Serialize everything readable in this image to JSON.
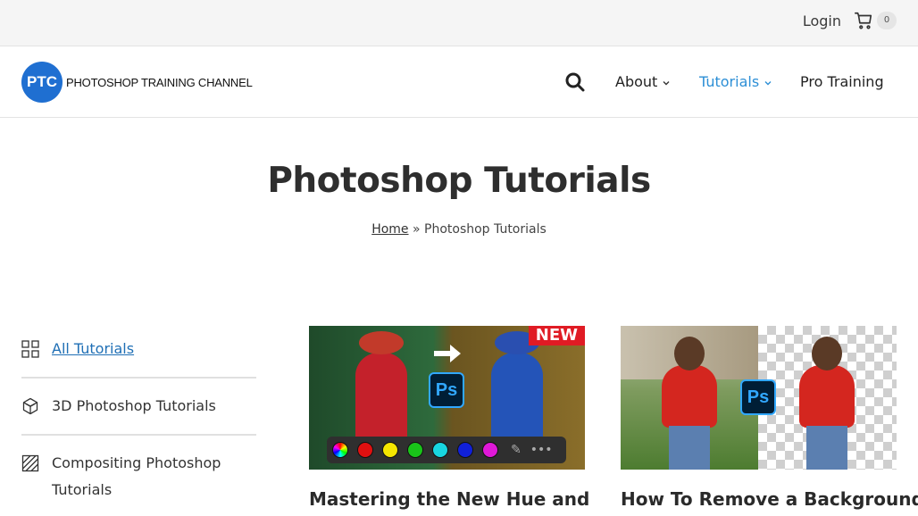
{
  "topbar": {
    "login_label": "Login",
    "cart_count": "0"
  },
  "header": {
    "logo_initials": "PTC",
    "logo_text": "PHOTOSHOP TRAINING CHANNEL",
    "nav": [
      {
        "label": "About",
        "has_dropdown": true
      },
      {
        "label": "Tutorials",
        "has_dropdown": true,
        "active": true
      },
      {
        "label": "Pro Training",
        "has_dropdown": false
      }
    ],
    "accent_color": "#2d8fd6"
  },
  "page": {
    "title": "Photoshop Tutorials",
    "breadcrumb": {
      "home": "Home",
      "separator": "»",
      "current": "Photoshop Tutorials"
    }
  },
  "sidebar": {
    "items": [
      {
        "label": "All Tutorials",
        "icon": "grid-icon",
        "active": true
      },
      {
        "label": "3D Photoshop Tutorials",
        "icon": "cube-icon"
      },
      {
        "label": "Compositing Photoshop Tutorials",
        "icon": "compositing-icon"
      }
    ]
  },
  "cards": [
    {
      "title": "Mastering the New Hue and",
      "badge": "NEW",
      "ps_label": "Ps"
    },
    {
      "title": "How To Remove a Background",
      "ps_label": "Ps"
    }
  ]
}
